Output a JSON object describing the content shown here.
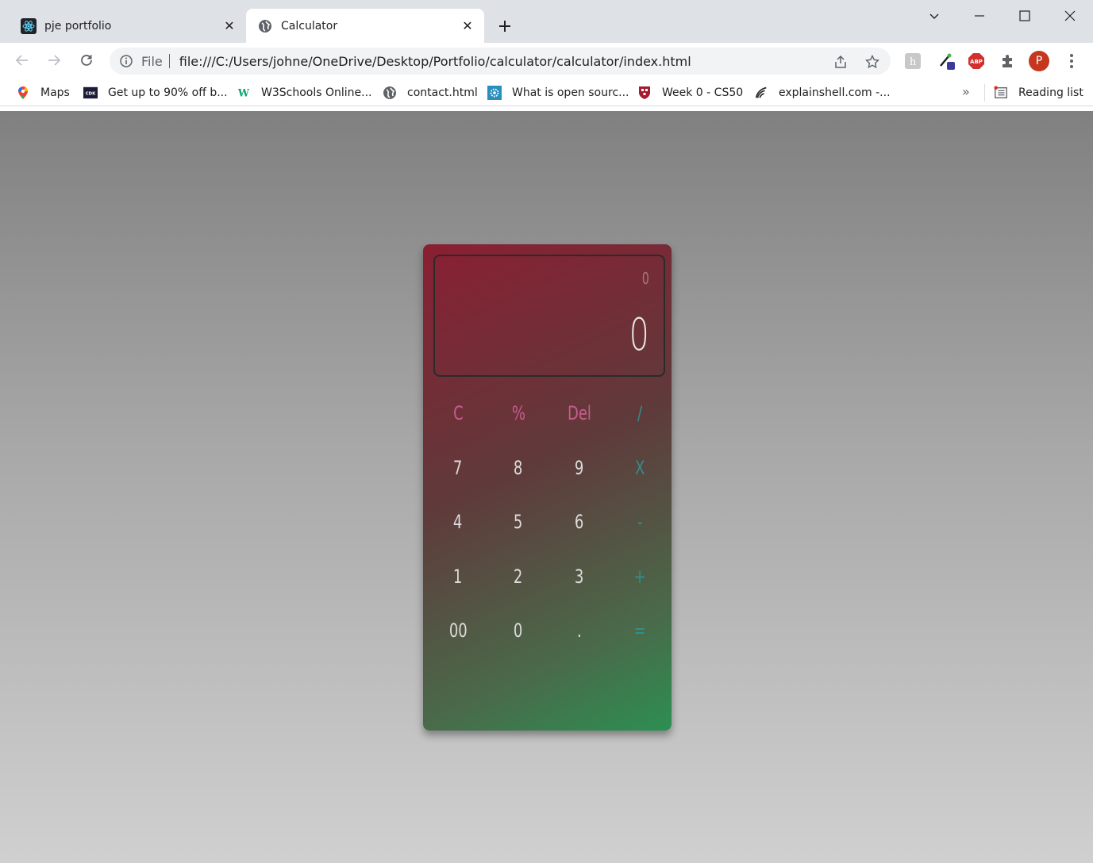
{
  "browser": {
    "tabs": [
      {
        "title": "pje portfolio",
        "active": false
      },
      {
        "title": "Calculator",
        "active": true
      }
    ],
    "address": {
      "scheme": "File",
      "url": "file:///C:/Users/johne/OneDrive/Desktop/Portfolio/calculator/calculator/index.html"
    },
    "profile_initial": "P",
    "bookmarks": [
      "Maps",
      "Get up to 90% off b...",
      "W3Schools Online...",
      "contact.html",
      "What is open sourc...",
      "Week 0 - CS50",
      "explainshell.com -..."
    ],
    "bookmarks_more": "»",
    "reading_list": "Reading list"
  },
  "calculator": {
    "previous_operand": "0",
    "current_operand": "0",
    "keys": [
      {
        "label": "C",
        "kind": "fn"
      },
      {
        "label": "%",
        "kind": "fn"
      },
      {
        "label": "Del",
        "kind": "fn"
      },
      {
        "label": "/",
        "kind": "op"
      },
      {
        "label": "7",
        "kind": "num"
      },
      {
        "label": "8",
        "kind": "num"
      },
      {
        "label": "9",
        "kind": "num"
      },
      {
        "label": "X",
        "kind": "op"
      },
      {
        "label": "4",
        "kind": "num"
      },
      {
        "label": "5",
        "kind": "num"
      },
      {
        "label": "6",
        "kind": "num"
      },
      {
        "label": "-",
        "kind": "op"
      },
      {
        "label": "1",
        "kind": "num"
      },
      {
        "label": "2",
        "kind": "num"
      },
      {
        "label": "3",
        "kind": "num"
      },
      {
        "label": "+",
        "kind": "op"
      },
      {
        "label": "00",
        "kind": "num"
      },
      {
        "label": "0",
        "kind": "num"
      },
      {
        "label": ".",
        "kind": "num"
      },
      {
        "label": "=",
        "kind": "op"
      }
    ]
  },
  "colors": {
    "fn_key": "#c75c8c",
    "op_key": "#2f8f8f",
    "calc_gradient_start": "#8a1f32",
    "calc_gradient_end": "#2c8f52"
  }
}
